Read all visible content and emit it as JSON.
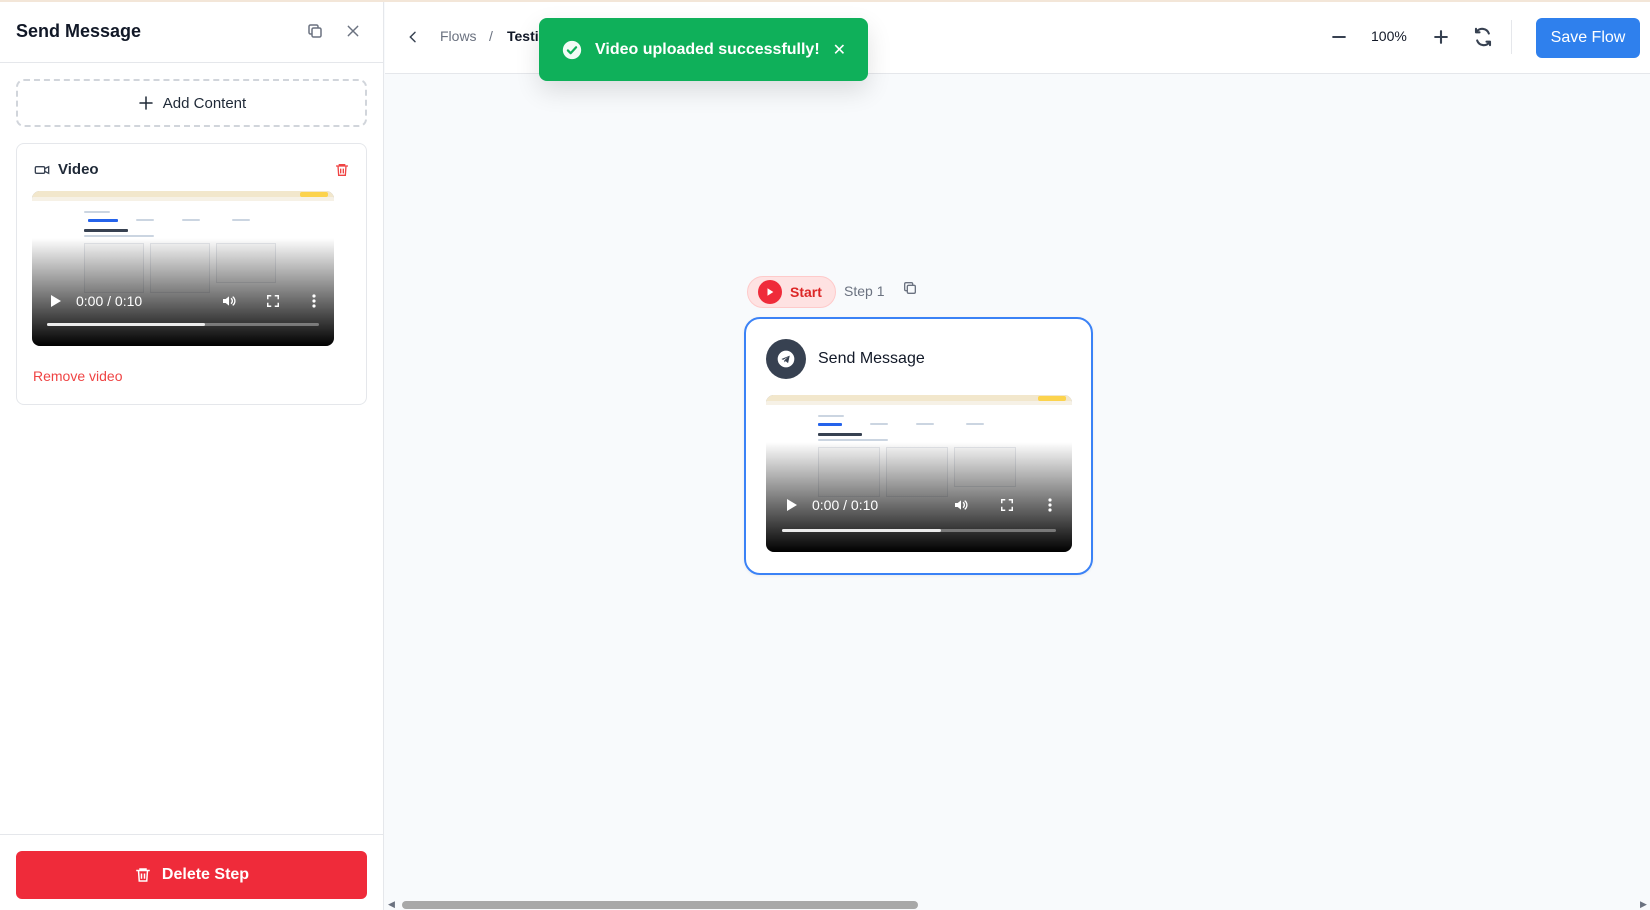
{
  "sidebar": {
    "title": "Send Message",
    "add_content_label": "Add Content",
    "video_card": {
      "title": "Video",
      "time": "0:00 / 0:10",
      "progress": 0.58,
      "remove_label": "Remove video"
    },
    "delete_label": "Delete Step"
  },
  "topbar": {
    "crumbs": {
      "root": "Flows",
      "separator": "/",
      "current": "Testi"
    },
    "zoom_level": "100%",
    "save_label": "Save Flow"
  },
  "toast": {
    "message": "Video uploaded successfully!",
    "close_glyph": "✕"
  },
  "canvas": {
    "start_label": "Start",
    "step_label": "Step 1",
    "node": {
      "title": "Send Message",
      "video_time": "0:00 / 0:10",
      "progress": 0.58
    }
  },
  "colors": {
    "primary": "#2f80ed",
    "danger": "#ef2b3a",
    "success": "#0fb05a",
    "node_border": "#3b82f6"
  }
}
